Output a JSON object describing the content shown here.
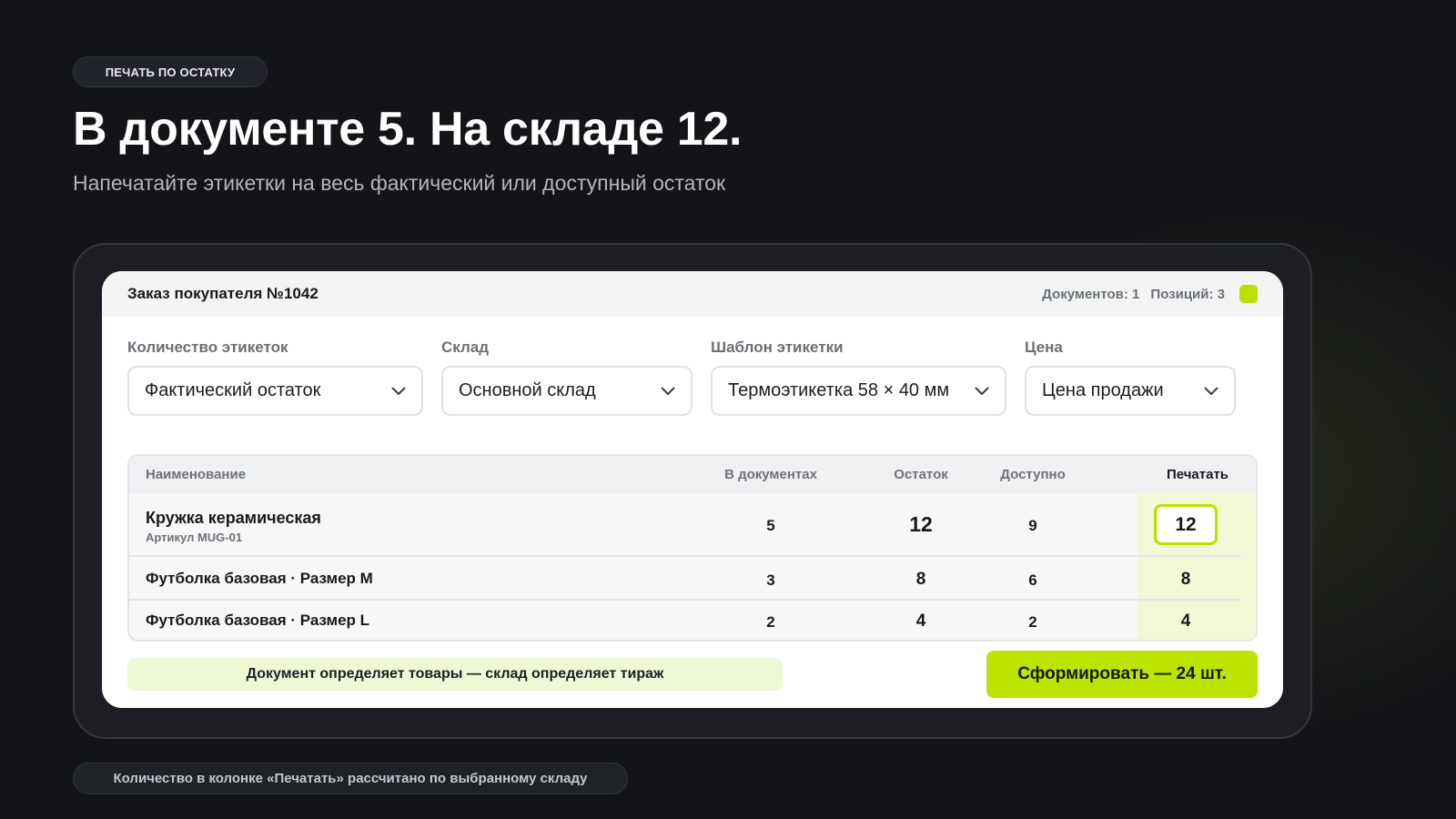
{
  "hero": {
    "badge": "ПЕЧАТЬ ПО ОСТАТКУ",
    "title": "В документе 5. На складе 12.",
    "subtitle": "Напечатайте этикетки на весь фактический или доступный остаток"
  },
  "card": {
    "title": "Заказ покупателя №1042",
    "documents_count": "Документов: 1",
    "positions_count": "Позиций: 3"
  },
  "filters": [
    {
      "label": "Количество этикеток",
      "value": "Фактический остаток"
    },
    {
      "label": "Склад",
      "value": "Основной склад"
    },
    {
      "label": "Шаблон этикетки",
      "value": "Термоэтикетка 58 × 40 мм"
    },
    {
      "label": "Цена",
      "value": "Цена продажи"
    }
  ],
  "table": {
    "headers": {
      "name": "Наименование",
      "in_docs": "В документах",
      "stock": "Остаток",
      "available": "Доступно",
      "print": "Печатать"
    },
    "rows": [
      {
        "name": "Кружка керамическая",
        "sku": "Артикул MUG-01",
        "in_docs": "5",
        "stock": "12",
        "available": "9",
        "print": "12"
      },
      {
        "name": "Футболка базовая · Размер M",
        "in_docs": "3",
        "stock": "8",
        "available": "6",
        "print": "8"
      },
      {
        "name": "Футболка базовая · Размер L",
        "in_docs": "2",
        "stock": "4",
        "available": "2",
        "print": "4"
      }
    ]
  },
  "footer": {
    "note": "Документ определяет товары — склад определяет тираж",
    "generate_label": "Сформировать — 24 шт."
  },
  "bottom_note": "Количество в колонке «Печатать» рассчитано по выбранному складу",
  "colors": {
    "accent": "#bde400",
    "background": "#121417",
    "print_column": "#f1f8d6"
  },
  "icons": {
    "select_arrow": "chevron-down-icon",
    "status": "status-square-icon"
  }
}
